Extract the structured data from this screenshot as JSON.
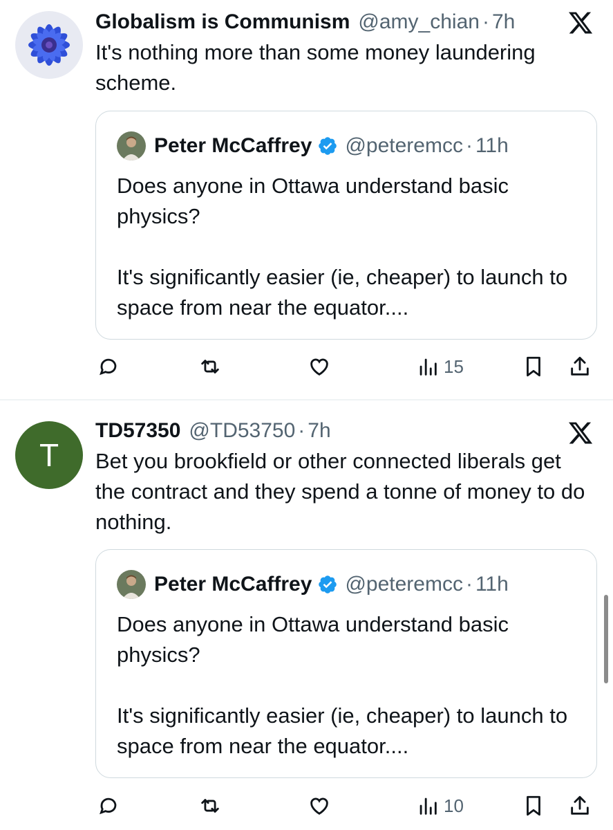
{
  "tweets": [
    {
      "author_name": "Globalism is Communism",
      "author_handle": "@amy_chian",
      "separator": "·",
      "time": "7h",
      "text": "It's nothing more than some money laundering scheme.",
      "quote": {
        "author_name": "Peter McCaffrey",
        "author_handle": "@peteremcc",
        "time": "11h",
        "para1": "Does anyone in Ottawa understand basic physics?",
        "para2": "It's significantly easier (ie, cheaper) to launch to space from near the equator...."
      },
      "views": "15"
    },
    {
      "author_name": "TD57350",
      "author_handle": "@TD53750",
      "separator": "·",
      "time": "7h",
      "avatar_letter": "T",
      "text": "Bet you brookfield or other connected liberals get the contract and they spend a tonne of money to do nothing.",
      "quote": {
        "author_name": "Peter McCaffrey",
        "author_handle": "@peteremcc",
        "time": "11h",
        "para1": "Does anyone in Ottawa understand basic physics?",
        "para2": "It's significantly easier (ie, cheaper) to launch to space from near the equator...."
      },
      "views": "10"
    }
  ],
  "icons": {
    "reply": "reply-icon",
    "repost": "repost-icon",
    "like": "like-icon",
    "views": "views-icon",
    "bookmark": "bookmark-icon",
    "share": "share-icon",
    "x_logo": "x-logo-icon",
    "verified": "verified-badge-icon"
  },
  "colors": {
    "text": "#0f1419",
    "secondary": "#536471",
    "verified": "#1d9bf0",
    "td_avatar": "#3f6b2b",
    "border": "#cfd9de"
  }
}
